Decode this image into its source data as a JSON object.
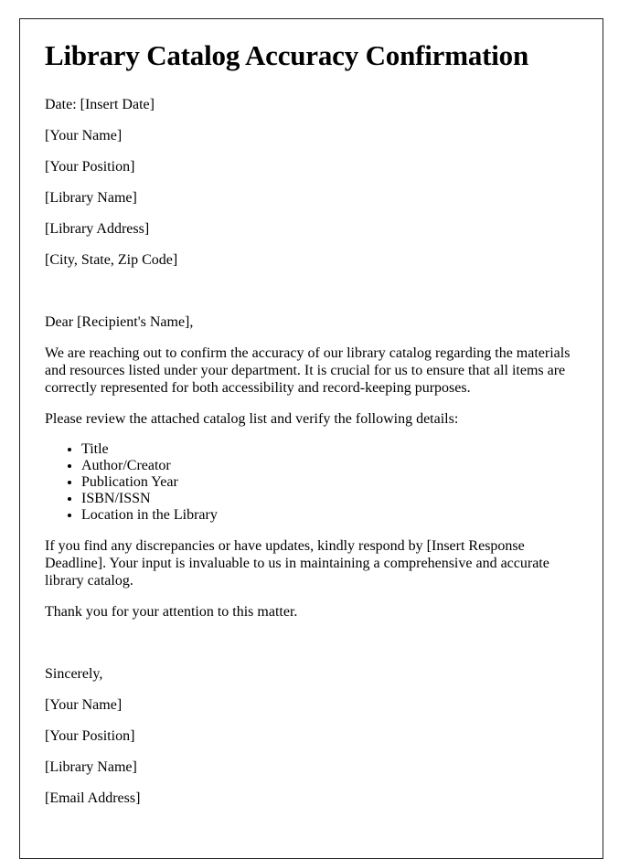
{
  "document": {
    "title": "Library Catalog Accuracy Confirmation",
    "date_line": "Date: [Insert Date]",
    "sender_block": [
      "[Your Name]",
      "[Your Position]",
      "[Library Name]",
      "[Library Address]",
      "[City, State, Zip Code]"
    ],
    "salutation": "Dear [Recipient's Name],",
    "paragraph_1": "We are reaching out to confirm the accuracy of our library catalog regarding the materials and resources listed under your department. It is crucial for us to ensure that all items are correctly represented for both accessibility and record-keeping purposes.",
    "paragraph_2": "Please review the attached catalog list and verify the following details:",
    "detail_items": [
      "Title",
      "Author/Creator",
      "Publication Year",
      "ISBN/ISSN",
      "Location in the Library"
    ],
    "paragraph_3": "If you find any discrepancies or have updates, kindly respond by [Insert Response Deadline]. Your input is invaluable to us in maintaining a comprehensive and accurate library catalog.",
    "paragraph_4": "Thank you for your attention to this matter.",
    "closing": "Sincerely,",
    "signature_block": [
      "[Your Name]",
      "[Your Position]",
      "[Library Name]",
      "[Email Address]"
    ]
  },
  "style": {
    "page_background": "#ffffff",
    "page_border_color": "#222222",
    "text_color": "#000000"
  }
}
